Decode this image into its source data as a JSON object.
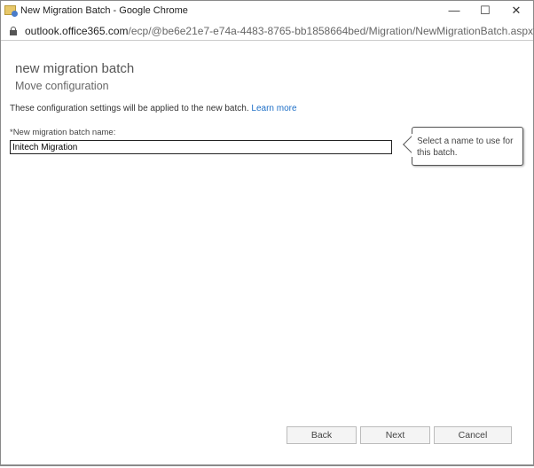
{
  "window": {
    "title": "New Migration Batch - Google Chrome",
    "minimize": "—",
    "maximize": "☐",
    "close": "✕"
  },
  "address": {
    "host": "outlook.office365.com",
    "path": "/ecp/@be6e21e7-e74a-4483-8765-bb1858664bed/Migration/NewMigrationBatch.aspx?..."
  },
  "page": {
    "title": "new migration batch",
    "subtitle": "Move configuration",
    "info": "These configuration settings will be applied to the new batch.",
    "learn_more": "Learn more",
    "name_label": "*New migration batch name:",
    "name_value": "Initech Migration",
    "tooltip": "Select a name to use for this batch."
  },
  "buttons": {
    "back": "Back",
    "next": "Next",
    "cancel": "Cancel"
  },
  "colors": {
    "link": "#1e6fc7"
  }
}
